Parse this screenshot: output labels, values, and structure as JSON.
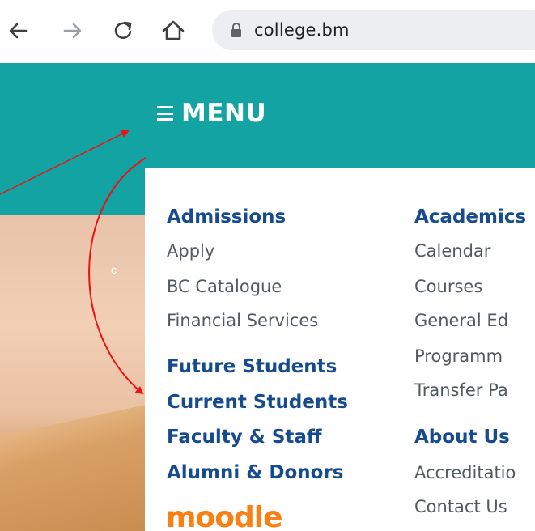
{
  "browser": {
    "url": "college.bm",
    "icons": [
      "back-arrow-icon",
      "forward-arrow-icon",
      "reload-icon",
      "home-icon",
      "lock-icon"
    ]
  },
  "header": {
    "menu_label": "MENU"
  },
  "hero": {
    "letter": "c"
  },
  "menu": {
    "column1": {
      "heading": "Admissions",
      "links": [
        "Apply",
        "BC Catalogue",
        "Financial Services"
      ],
      "sections": [
        "Future Students",
        "Current Students",
        "Faculty & Staff",
        "Alumni & Donors"
      ]
    },
    "column2": {
      "heading": "Academics",
      "links": [
        "Calendar",
        "Courses",
        "General Ed",
        "Programm",
        "Transfer Pa"
      ],
      "heading2": "About Us",
      "links2": [
        "Accreditatio",
        "Contact Us"
      ]
    },
    "logo": "moodle"
  },
  "colors": {
    "teal": "#14a3a3",
    "heading_blue": "#164c8f",
    "link_gray": "#525a61",
    "annotation_red": "#ee1111",
    "moodle_orange": "#f98012"
  }
}
